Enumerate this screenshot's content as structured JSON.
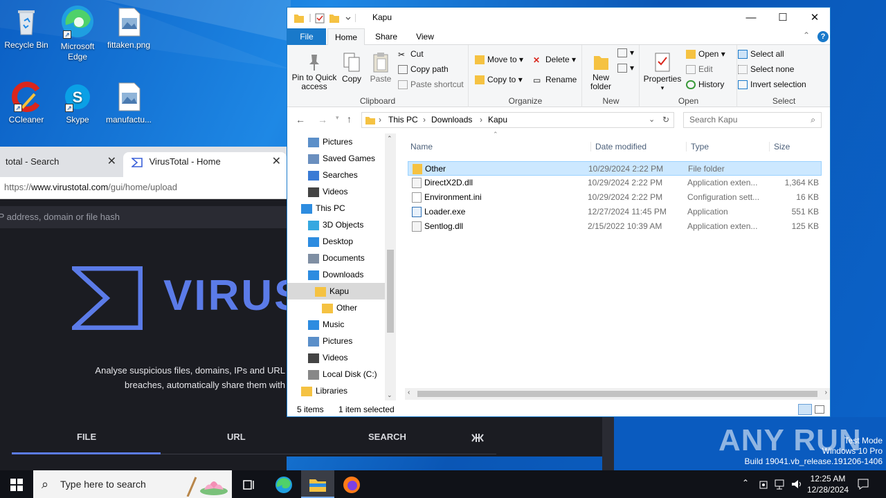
{
  "desktop": {
    "icons": [
      {
        "label": "Recycle Bin"
      },
      {
        "label": "Microsoft Edge"
      },
      {
        "label": "fittaken.png"
      },
      {
        "label": "CCleaner"
      },
      {
        "label": "Skype"
      },
      {
        "label": "manufactu..."
      }
    ]
  },
  "browser": {
    "tab1_title": "total - Search",
    "tab2_title": "VirusTotal - Home",
    "url_prefix": "https://",
    "url_domain": "www.virustotal.com",
    "url_path": "/gui/home/upload",
    "search_placeholder": "IP address, domain or file hash",
    "logo_word": "VIRUS",
    "tagline1": "Analyse suspicious files, domains, IPs and URL",
    "tagline2": "breaches, automatically share them with",
    "tabs": [
      "FILE",
      "URL",
      "SEARCH"
    ],
    "accent": "#5b7be8"
  },
  "explorer": {
    "title": "Kapu",
    "ribbon_tabs": [
      "File",
      "Home",
      "Share",
      "View"
    ],
    "clipboard": {
      "pin": "Pin to Quick access",
      "copy": "Copy",
      "paste": "Paste",
      "cut": "Cut",
      "copy_path": "Copy path",
      "paste_shortcut": "Paste shortcut",
      "group": "Clipboard"
    },
    "organize": {
      "move_to": "Move to",
      "copy_to": "Copy to",
      "delete": "Delete",
      "rename": "Rename",
      "group": "Organize"
    },
    "new": {
      "new_folder": "New folder",
      "group": "New"
    },
    "open": {
      "properties": "Properties",
      "open": "Open",
      "edit": "Edit",
      "history": "History",
      "group": "Open"
    },
    "select": {
      "select_all": "Select all",
      "select_none": "Select none",
      "invert": "Invert selection",
      "group": "Select"
    },
    "breadcrumb": [
      "This PC",
      "Downloads",
      "Kapu"
    ],
    "search_placeholder": "Search Kapu",
    "nav": [
      {
        "label": "Pictures",
        "level": 1
      },
      {
        "label": "Saved Games",
        "level": 1
      },
      {
        "label": "Searches",
        "level": 1
      },
      {
        "label": "Videos",
        "level": 1
      },
      {
        "label": "This PC",
        "level": 0
      },
      {
        "label": "3D Objects",
        "level": 1
      },
      {
        "label": "Desktop",
        "level": 1
      },
      {
        "label": "Documents",
        "level": 1
      },
      {
        "label": "Downloads",
        "level": 1
      },
      {
        "label": "Kapu",
        "level": 2,
        "selected": true
      },
      {
        "label": "Other",
        "level": 3
      },
      {
        "label": "Music",
        "level": 1
      },
      {
        "label": "Pictures",
        "level": 1
      },
      {
        "label": "Videos",
        "level": 1
      },
      {
        "label": "Local Disk (C:)",
        "level": 1
      },
      {
        "label": "Libraries",
        "level": 0
      }
    ],
    "columns": [
      "Name",
      "Date modified",
      "Type",
      "Size"
    ],
    "files": [
      {
        "name": "Other",
        "date": "10/29/2024 2:22 PM",
        "type": "File folder",
        "size": "",
        "kind": "folder",
        "selected": true
      },
      {
        "name": "DirectX2D.dll",
        "date": "10/29/2024 2:22 PM",
        "type": "Application exten...",
        "size": "1,364 KB",
        "kind": "dll"
      },
      {
        "name": "Environment.ini",
        "date": "10/29/2024 2:22 PM",
        "type": "Configuration sett...",
        "size": "16 KB",
        "kind": "ini"
      },
      {
        "name": "Loader.exe",
        "date": "12/27/2024 11:45 PM",
        "type": "Application",
        "size": "551 KB",
        "kind": "exe"
      },
      {
        "name": "Sentlog.dll",
        "date": "2/15/2022 10:39 AM",
        "type": "Application exten...",
        "size": "125 KB",
        "kind": "dll"
      }
    ],
    "status_items": "5 items",
    "status_selected": "1 item selected"
  },
  "watermark": {
    "brand": "ANY RUN",
    "line1": "Test Mode",
    "line2": "Windows 10 Pro",
    "line3": "Build 19041.vb_release.191206-1406"
  },
  "taskbar": {
    "search_placeholder": "Type here to search",
    "time": "12:25 AM",
    "date": "12/28/2024"
  }
}
